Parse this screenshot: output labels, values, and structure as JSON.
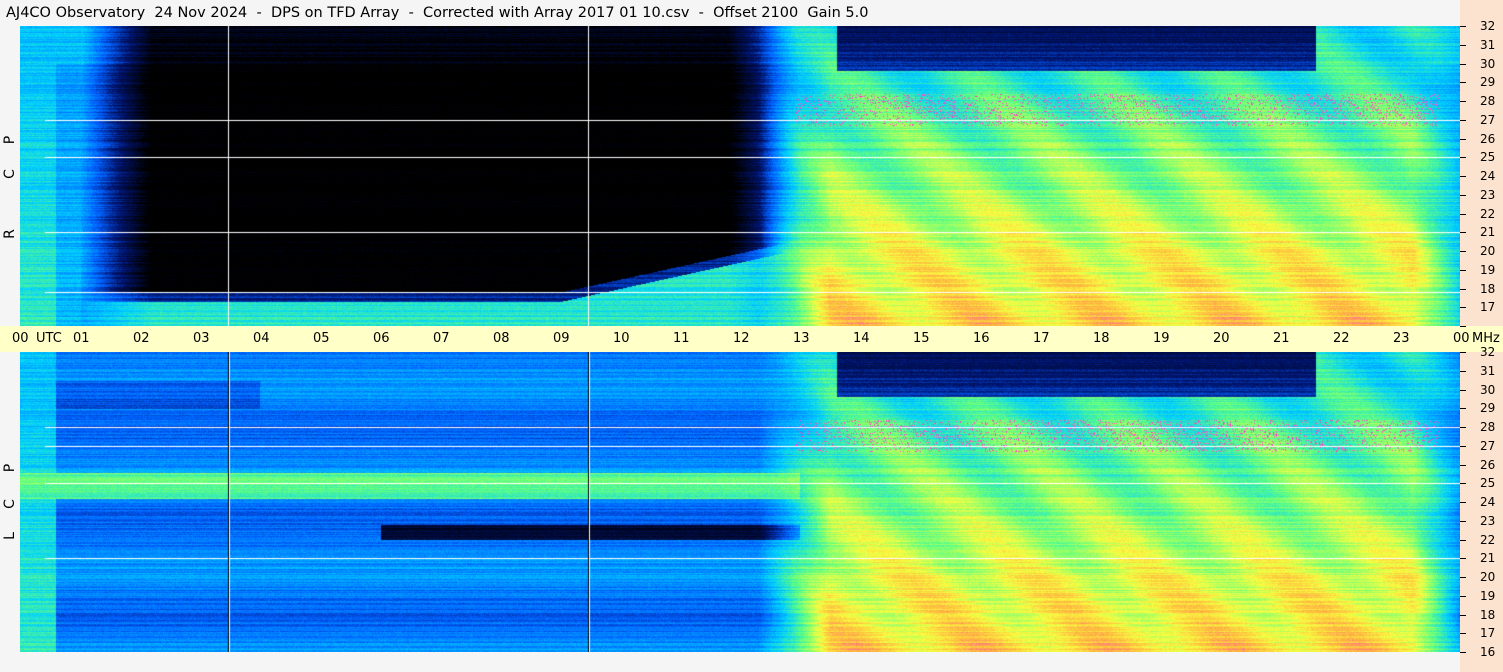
{
  "title": "AJ4CO Observatory  24 Nov 2024  -  DPS on TFD Array  -  Corrected with Array 2017 01 10.csv  -  Offset 2100  Gain 5.0",
  "panels": [
    {
      "id": "top",
      "label_letters": [
        "R",
        "C",
        "P"
      ]
    },
    {
      "id": "bottom",
      "label_letters": [
        "L",
        "C",
        "P"
      ]
    }
  ],
  "colors": {
    "background_low": "#000000",
    "mid_blue": "#0060ff",
    "cyan": "#00d0ff",
    "green": "#60ff80",
    "yellow": "#f8ff40",
    "orange": "#ffb040",
    "magenta": "#ff30e0",
    "white_line": "#ffffff",
    "utc_bar": "#ffffc8",
    "freq_strip": "#fbe3cf"
  },
  "chart_data": {
    "type": "heatmap",
    "title": "AJ4CO Observatory  24 Nov 2024  -  DPS on TFD Array  -  Corrected with Array 2017 01 10.csv  -  Offset 2100  Gain 5.0",
    "x_axis": {
      "label": "UTC",
      "tick_labels": [
        "00",
        "01",
        "02",
        "03",
        "04",
        "05",
        "06",
        "07",
        "08",
        "09",
        "10",
        "11",
        "12",
        "13",
        "14",
        "15",
        "16",
        "17",
        "18",
        "19",
        "20",
        "21",
        "22",
        "23",
        "00"
      ],
      "range_hours": [
        0,
        24
      ]
    },
    "y_axis": {
      "label": "MHz",
      "tick_labels": [
        "32",
        "31",
        "30",
        "29",
        "28",
        "27",
        "26",
        "25",
        "24",
        "23",
        "22",
        "21",
        "20",
        "19",
        "18",
        "17",
        "16"
      ],
      "range_mhz": [
        16,
        32
      ]
    },
    "series": [
      {
        "name": "R C P",
        "panel": "top"
      },
      {
        "name": "L C P",
        "panel": "bottom"
      }
    ],
    "features": {
      "vertical_lines_utc_hours": [
        3.47,
        9.47
      ],
      "dark_band_utc_hours": [
        13.6,
        21.6
      ],
      "rfi_white_lines_mhz_top": [
        27.0,
        25.0,
        21.0,
        17.8
      ],
      "rfi_white_lines_mhz_bottom": [
        28.0,
        27.0,
        21.0,
        25.0
      ]
    }
  }
}
